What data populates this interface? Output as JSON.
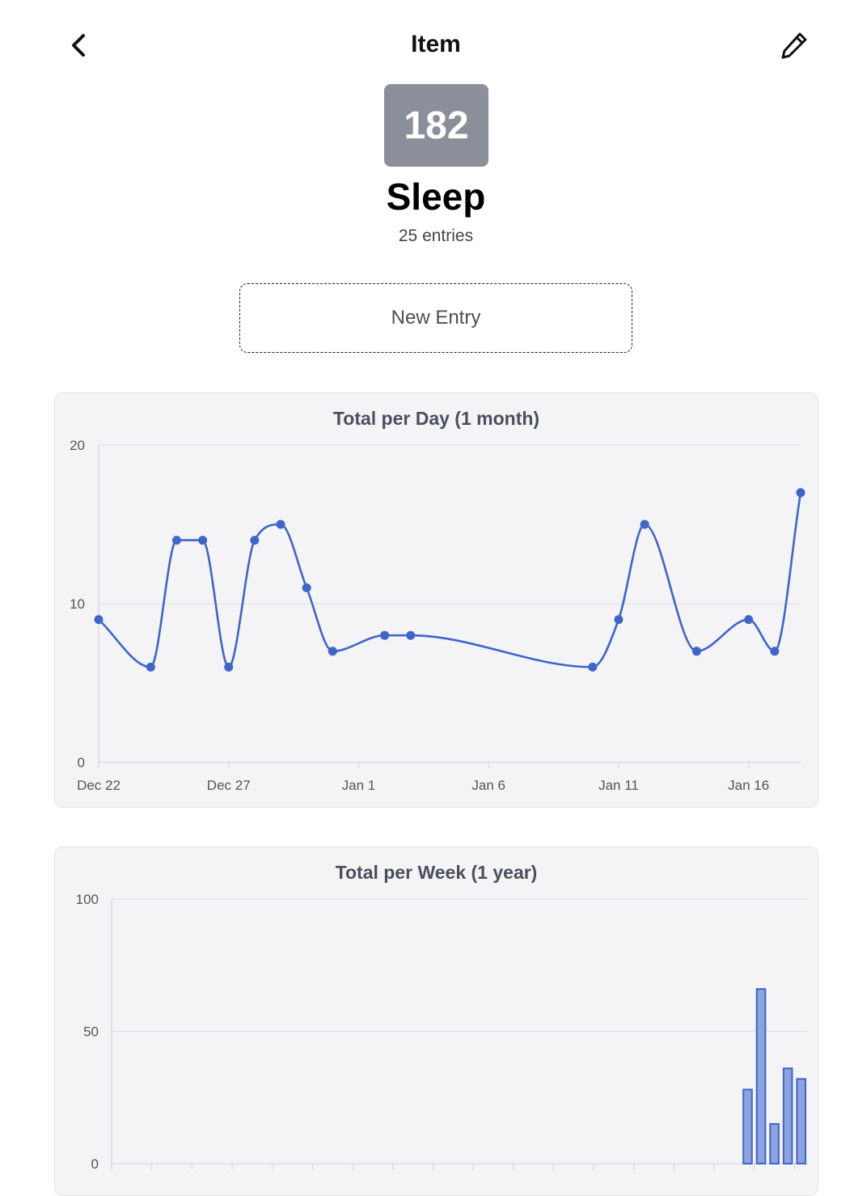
{
  "header": {
    "title": "Item"
  },
  "item": {
    "badge": "182",
    "name": "Sleep",
    "entries": "25 entries"
  },
  "actions": {
    "new_entry_label": "New Entry"
  },
  "colors": {
    "accent": "#3f65c9",
    "bar_fill": "#8da3e0",
    "badge": "#8c8f99"
  },
  "icons": {
    "back": "chevron-left-icon",
    "edit": "pencil-icon"
  },
  "chart_data": [
    {
      "type": "line",
      "title": "Total per Day (1 month)",
      "ylim": [
        0,
        20
      ],
      "y_ticks": [
        "0",
        "10",
        "20"
      ],
      "x_ticks": [
        "Dec 22",
        "Dec 27",
        "Jan 1",
        "Jan 6",
        "Jan 11",
        "Jan 16"
      ],
      "x_tick_days": [
        0,
        5,
        10,
        15,
        20,
        25
      ],
      "points_day": [
        0,
        2,
        3,
        4,
        5,
        6,
        7,
        8,
        9,
        11,
        12,
        19,
        20,
        21,
        23,
        25,
        26,
        27
      ],
      "values": [
        9,
        6,
        14,
        14,
        6,
        14,
        15,
        11,
        7,
        8,
        8,
        6,
        9,
        15,
        7,
        9,
        7,
        17
      ],
      "grid": true,
      "legend": "none"
    },
    {
      "type": "bar",
      "title": "Total per Week (1 year)",
      "ylim": [
        0,
        100
      ],
      "y_ticks": [
        "0",
        "50",
        "100"
      ],
      "weeks": 52,
      "bars": [
        {
          "week": 47,
          "value": 28
        },
        {
          "week": 48,
          "value": 66
        },
        {
          "week": 49,
          "value": 15
        },
        {
          "week": 50,
          "value": 36
        },
        {
          "week": 51,
          "value": 32
        }
      ],
      "grid": true,
      "legend": "none"
    }
  ]
}
